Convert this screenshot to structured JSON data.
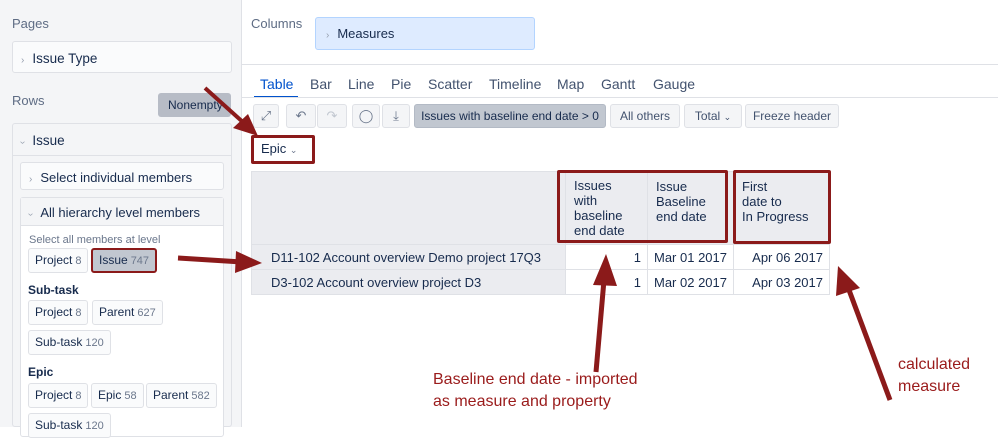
{
  "left": {
    "pages_title": "Pages",
    "pages_item": "Issue Type",
    "rows_title": "Rows",
    "nonempty_label": "Nonempty",
    "issue_label": "Issue",
    "select_individual": "Select individual members",
    "all_hierarchy": "All hierarchy level members",
    "select_all_at_level": "Select all members at level",
    "level_issue": [
      {
        "label": "Project",
        "count": "8"
      },
      {
        "label": "Issue",
        "count": "747"
      }
    ],
    "subtask_head": "Sub-task",
    "level_subtask": [
      {
        "label": "Project",
        "count": "8"
      },
      {
        "label": "Parent",
        "count": "627"
      },
      {
        "label": "Sub-task",
        "count": "120"
      }
    ],
    "epic_head": "Epic",
    "level_epic": [
      {
        "label": "Project",
        "count": "8"
      },
      {
        "label": "Epic",
        "count": "58"
      },
      {
        "label": "Parent",
        "count": "582"
      },
      {
        "label": "Sub-task",
        "count": "120"
      }
    ]
  },
  "columns": {
    "title": "Columns",
    "measures_label": "Measures"
  },
  "tabs": [
    "Table",
    "Bar",
    "Line",
    "Pie",
    "Scatter",
    "Timeline",
    "Map",
    "Gantt",
    "Gauge"
  ],
  "toolbar": {
    "expand_icon": "expand-icon",
    "undo_icon": "undo-icon",
    "redo_icon": "redo-icon",
    "comment_icon": "comment-icon",
    "export_icon": "export-icon",
    "filter_label": "Issues with baseline end date > 0",
    "all_others": "All others",
    "total": "Total",
    "freeze_header": "Freeze header"
  },
  "epic_dropdown": "Epic",
  "table": {
    "headers": [
      [
        "Issues",
        "with",
        "baseline",
        "end date"
      ],
      [
        "Issue",
        "Baseline",
        "end date"
      ],
      [
        "First",
        "date to",
        "In Progress"
      ]
    ],
    "rows": [
      {
        "name": "D11-102 Account overview Demo project 17Q3",
        "issues": "1",
        "baseline": "Mar 01 2017",
        "first": "Apr 06 2017"
      },
      {
        "name": "D3-102 Account overview project D3",
        "issues": "1",
        "baseline": "Mar 02 2017",
        "first": "Apr 03 2017"
      }
    ]
  },
  "annotations": {
    "baseline_line1": "Baseline end date - imported",
    "baseline_line2": "as measure and property",
    "calc_line1": "calculated",
    "calc_line2": "measure"
  },
  "colors": {
    "annotation_red": "#8b1a1a",
    "active_tab": "#0052cc"
  }
}
